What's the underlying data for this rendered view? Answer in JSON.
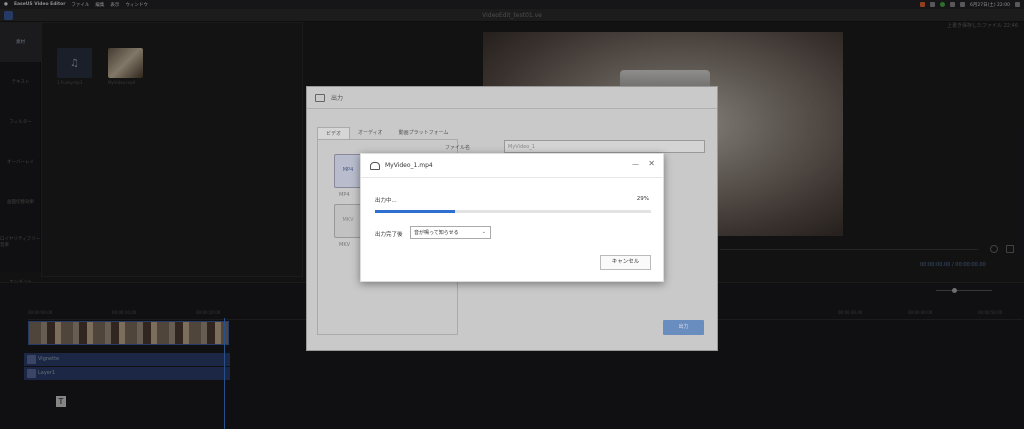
{
  "menubar": {
    "app_name": "EaseUS Video Editor",
    "items": [
      "ファイル",
      "編集",
      "表示",
      "ウィンドウ"
    ],
    "clock": "6月27日(土) 22:00"
  },
  "window": {
    "title": "VideoEdit_test01.ve",
    "saved_message": "上書き保存したファイル 22:46"
  },
  "leftnav": {
    "items": [
      "素材",
      "テキスト",
      "フィルター",
      "オーバーレイ",
      "画面切替効果",
      "ロイヤリティフリー音楽",
      "エレメント"
    ]
  },
  "media": {
    "items": [
      {
        "label": "1-Funky.mp3"
      },
      {
        "label": "MyVideo.mp4"
      }
    ]
  },
  "preview": {
    "timecode": "00:00:00.00 / 00:00:00.00"
  },
  "timeline": {
    "ticks": [
      "00:00:00.00",
      "00:00:10.00",
      "00:00:20.00",
      "00:00:30.00",
      "00:00:40.00",
      "00:00:50.00"
    ],
    "tracks": [
      {
        "name": "Vignette"
      },
      {
        "name": "Layer1"
      }
    ]
  },
  "export_dialog": {
    "title": "出力",
    "tabs": [
      "ビデオ",
      "オーディオ",
      "動画プラットフォーム"
    ],
    "formats": [
      {
        "label": "MP4",
        "name": "MP4"
      },
      {
        "label": "MKV",
        "name": "MKV"
      }
    ],
    "filename_label": "ファイル名",
    "filename_value": "MyVideo_1",
    "export_button": "出力"
  },
  "progress_dialog": {
    "filename": "MyVideo_1.mp4",
    "status": "出力中...",
    "percent_label": "29%",
    "progress": 0.29,
    "after_label": "出力完了後",
    "after_option": "音が鳴って知らせる",
    "cancel_button": "キャンセル",
    "accent": "#2f6fd0"
  }
}
